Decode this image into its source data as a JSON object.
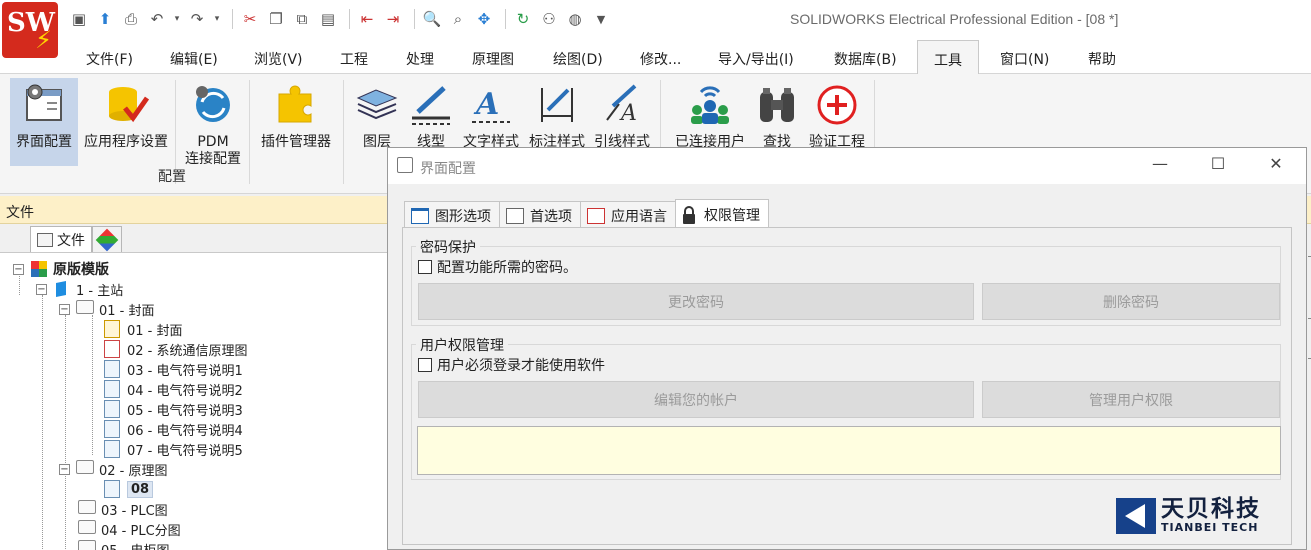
{
  "app": {
    "title": "SOLIDWORKS Electrical Professional Edition - [08 *]",
    "logo_text": "SW"
  },
  "menu": [
    {
      "label": "文件(F)"
    },
    {
      "label": "编辑(E)"
    },
    {
      "label": "浏览(V)"
    },
    {
      "label": "工程"
    },
    {
      "label": "处理"
    },
    {
      "label": "原理图"
    },
    {
      "label": "绘图(D)"
    },
    {
      "label": "修改..."
    },
    {
      "label": "导入/导出(I)"
    },
    {
      "label": "数据库(B)"
    },
    {
      "label": "工具"
    },
    {
      "label": "窗口(N)"
    },
    {
      "label": "帮助"
    }
  ],
  "ribbon": {
    "buttons": [
      {
        "label": "界面配置"
      },
      {
        "label": "应用程序设置"
      },
      {
        "label": "PDM\n连接配置"
      },
      {
        "label": "插件管理器"
      },
      {
        "label": "图层"
      },
      {
        "label": "线型"
      },
      {
        "label": "文字样式"
      },
      {
        "label": "标注样式"
      },
      {
        "label": "引线样式"
      },
      {
        "label": "已连接用户"
      },
      {
        "label": "查找"
      },
      {
        "label": "验证工程"
      }
    ],
    "group_label": "配置"
  },
  "panel": {
    "header": "文件",
    "tab_files": "文件"
  },
  "tree": {
    "root": "原版模版",
    "station": "1 - 主站",
    "folder1": "01 - 封面",
    "items1": [
      "01 - 封面",
      "02 - 系统通信原理图",
      "03 - 电气符号说明1",
      "04 - 电气符号说明2",
      "05 - 电气符号说明3",
      "06 - 电气符号说明4",
      "07 - 电气符号说明5"
    ],
    "folder2": "02 - 原理图",
    "item08": "08",
    "folder3": "03 - PLC图",
    "folder4": "04 - PLC分图",
    "folder5": "05 - 电柜图"
  },
  "dialog": {
    "title": "界面配置",
    "tabs": [
      {
        "label": "图形选项"
      },
      {
        "label": "首选项"
      },
      {
        "label": "应用语言"
      },
      {
        "label": "权限管理"
      }
    ],
    "password_group": "密码保护",
    "password_checkbox": "配置功能所需的密码。",
    "change_password": "更改密码",
    "delete_password": "删除密码",
    "user_group": "用户权限管理",
    "user_checkbox": "用户必须登录才能使用软件",
    "edit_account": "编辑您的帐户",
    "manage_rights": "管理用户权限"
  },
  "brand": {
    "cn": "天贝科技",
    "en": "TIANBEI TECH"
  },
  "colors": {
    "ribbon_active": "#c6d5ea",
    "panel_header": "#fdf0c8",
    "message_box": "#fffee0",
    "logo_red": "#d42a1d",
    "brand_blue": "#16418a"
  }
}
